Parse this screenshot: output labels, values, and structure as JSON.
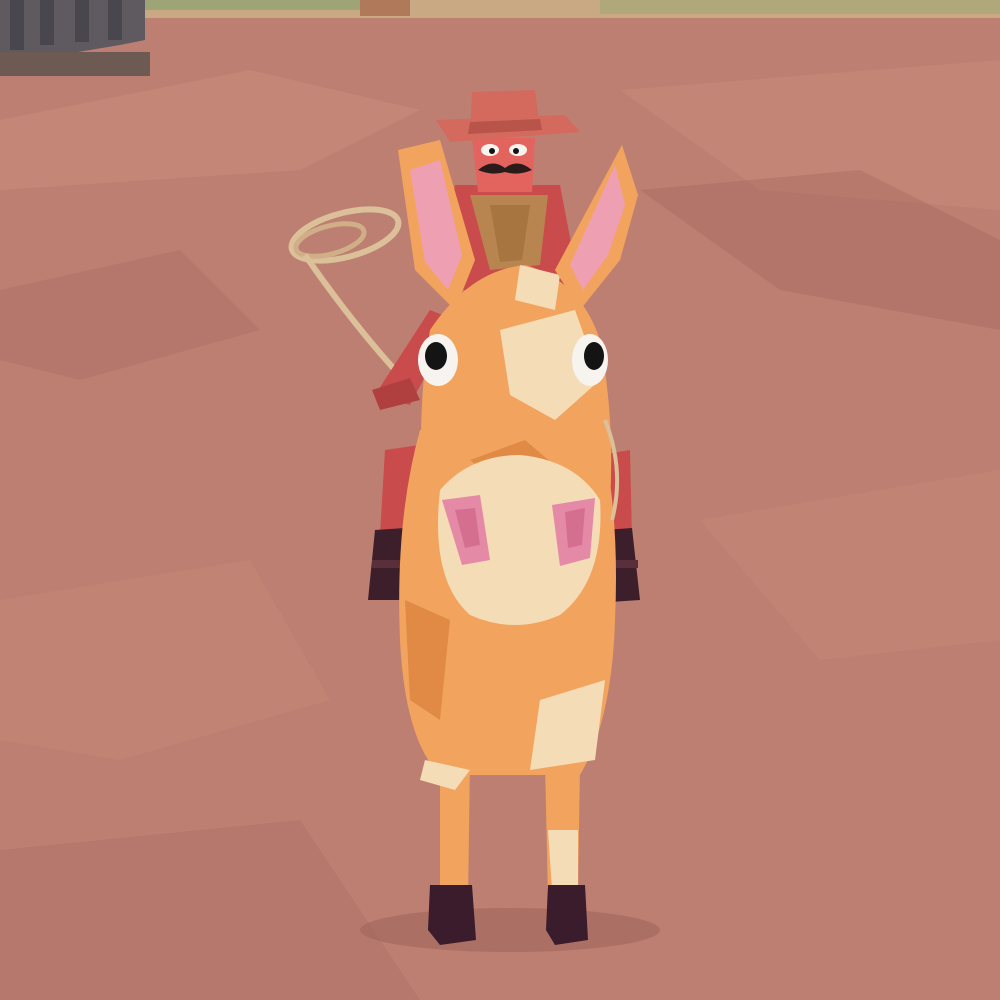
{
  "scene": {
    "ground_color": "#bd7f71",
    "ground_highlight": "#c98c7c",
    "ground_shadow": "#a76a60",
    "sky_strip_color": "#c9a983",
    "building_color": "#5f5a60"
  },
  "characters": [
    {
      "kind": "mule",
      "colors": {
        "orange": "#f2a45e",
        "orange_dark": "#e08a45",
        "cream": "#f4dcb6",
        "ear_pink": "#ee9fb2",
        "nostril_pink": "#e58aa6",
        "hoof": "#3a1c2c",
        "eye_white": "#f7f3ee",
        "eye_black": "#141414"
      }
    },
    {
      "kind": "cowboy-rider",
      "colors": {
        "hat": "#d4695e",
        "hat_band": "#b85449",
        "skin": "#e3645e",
        "shirt": "#c94b4b",
        "mustache": "#2a1a1a",
        "bandana": "#b8844f",
        "glove": "#3d1f2b",
        "lasso": "#dcc09a"
      }
    }
  ]
}
